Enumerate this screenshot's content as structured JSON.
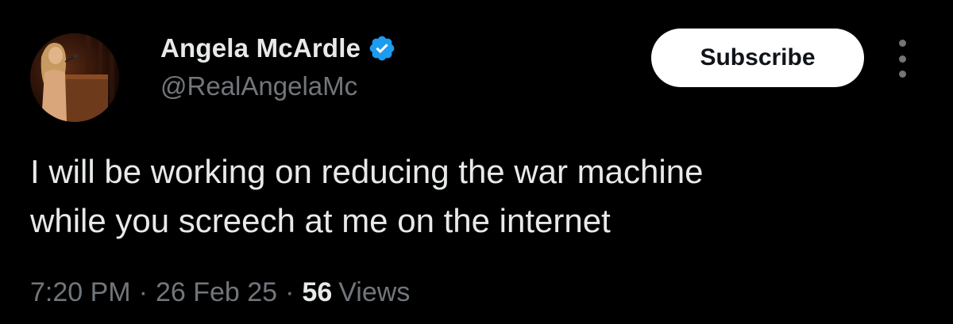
{
  "author": {
    "display_name": "Angela McArdle",
    "handle": "@RealAngelaMc",
    "verified": true,
    "verified_icon": "verified-badge-icon",
    "verified_color": "#1d9bf0"
  },
  "actions": {
    "subscribe_label": "Subscribe",
    "more_icon": "vertical-ellipsis-icon"
  },
  "tweet": {
    "lines": [
      "I will be working on reducing the war machine",
      "while you screech at me on the internet"
    ]
  },
  "meta": {
    "time": "7:20 PM",
    "separator": "·",
    "date": "26 Feb 25",
    "views_count": "56",
    "views_label": "Views"
  },
  "colors": {
    "background": "#000000",
    "primary_text": "#e7e9ea",
    "secondary_text": "#71767b",
    "button_bg": "#ffffff",
    "button_text": "#0f1419"
  }
}
